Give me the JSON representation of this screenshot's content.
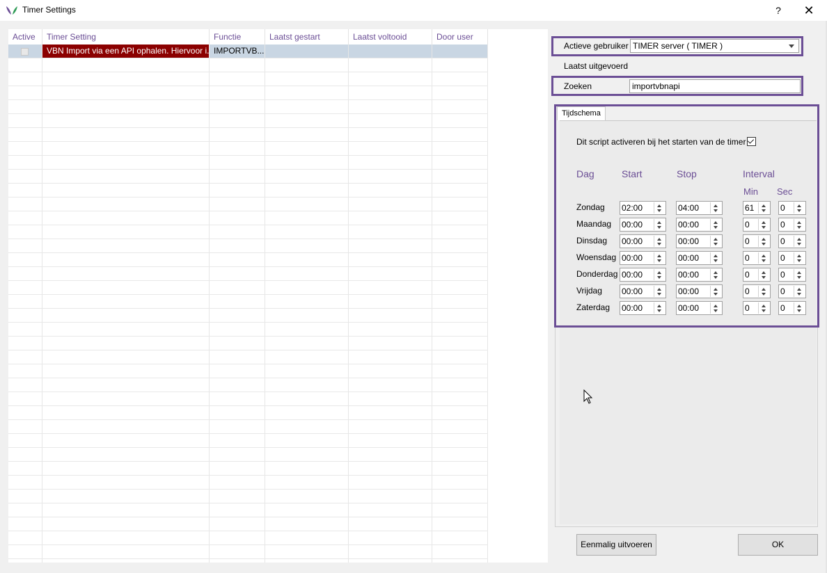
{
  "window": {
    "title": "Timer Settings",
    "help_label": "?",
    "close_label": "✕",
    "icon": "app-leaf-icon"
  },
  "grid": {
    "columns": [
      "Active",
      "Timer Setting",
      "Functie",
      "Laatst gestart",
      "Laatst voltooid",
      "Door user"
    ],
    "rows": [
      {
        "active": false,
        "timer_setting": "VBN Import via een API ophalen. Hiervoor i...",
        "functie": "IMPORTVB...",
        "laatst_gestart": "",
        "laatst_voltooid": "",
        "door_user": ""
      }
    ]
  },
  "right": {
    "actieve_gebruiker_label": "Actieve gebruiker",
    "actieve_gebruiker_value": "TIMER server  ( TIMER )",
    "laatst_uitgevoerd_label": "Laatst uitgevoerd",
    "zoeken_label": "Zoeken",
    "zoeken_value": "importvbnapi"
  },
  "schedule": {
    "tab_label": "Tijdschema",
    "activate_label": "Dit script activeren bij het starten van de timer",
    "activate_checked": true,
    "headers": {
      "dag": "Dag",
      "start": "Start",
      "stop": "Stop",
      "interval": "Interval",
      "min": "Min",
      "sec": "Sec"
    },
    "days": [
      {
        "name": "Zondag",
        "start": "02:00",
        "stop": "04:00",
        "min": "61",
        "sec": "0"
      },
      {
        "name": "Maandag",
        "start": "00:00",
        "stop": "00:00",
        "min": "0",
        "sec": "0"
      },
      {
        "name": "Dinsdag",
        "start": "00:00",
        "stop": "00:00",
        "min": "0",
        "sec": "0"
      },
      {
        "name": "Woensdag",
        "start": "00:00",
        "stop": "00:00",
        "min": "0",
        "sec": "0"
      },
      {
        "name": "Donderdag",
        "start": "00:00",
        "stop": "00:00",
        "min": "0",
        "sec": "0"
      },
      {
        "name": "Vrijdag",
        "start": "00:00",
        "stop": "00:00",
        "min": "0",
        "sec": "0"
      },
      {
        "name": "Zaterdag",
        "start": "00:00",
        "stop": "00:00",
        "min": "0",
        "sec": "0"
      }
    ]
  },
  "buttons": {
    "run_once": "Eenmalig uitvoeren",
    "ok": "OK"
  },
  "colors": {
    "accent": "#6b4e95",
    "selected_row": "#c9d6e3",
    "selected_cell": "#8b0000"
  }
}
